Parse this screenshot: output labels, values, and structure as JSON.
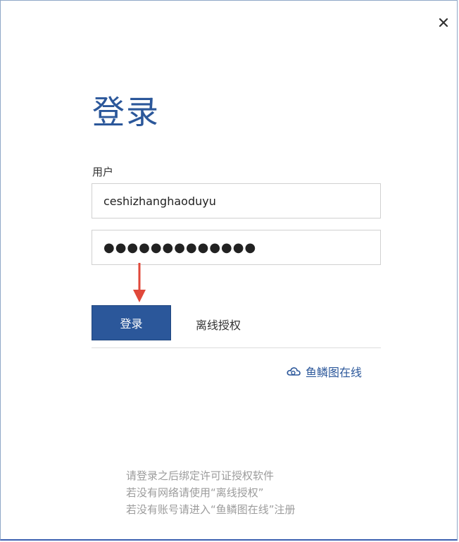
{
  "dialog": {
    "title": "登录",
    "close_icon": "close-icon"
  },
  "form": {
    "user_label": "用户",
    "username_value": "ceshizhanghaoduyu",
    "password_masked": "●●●●●●●●●●●●●",
    "login_button": "登录",
    "offline_link": "离线授权"
  },
  "online": {
    "icon": "cloud-icon",
    "label": "鱼鳞图在线"
  },
  "hints": [
    "请登录之后绑定许可证授权软件",
    "若没有网络请使用“离线授权”",
    "若没有账号请进入“鱼鳞图在线”注册"
  ],
  "colors": {
    "brand": "#2b579a",
    "arrow": "#e0483a",
    "hint_text": "#9c9c9c"
  }
}
